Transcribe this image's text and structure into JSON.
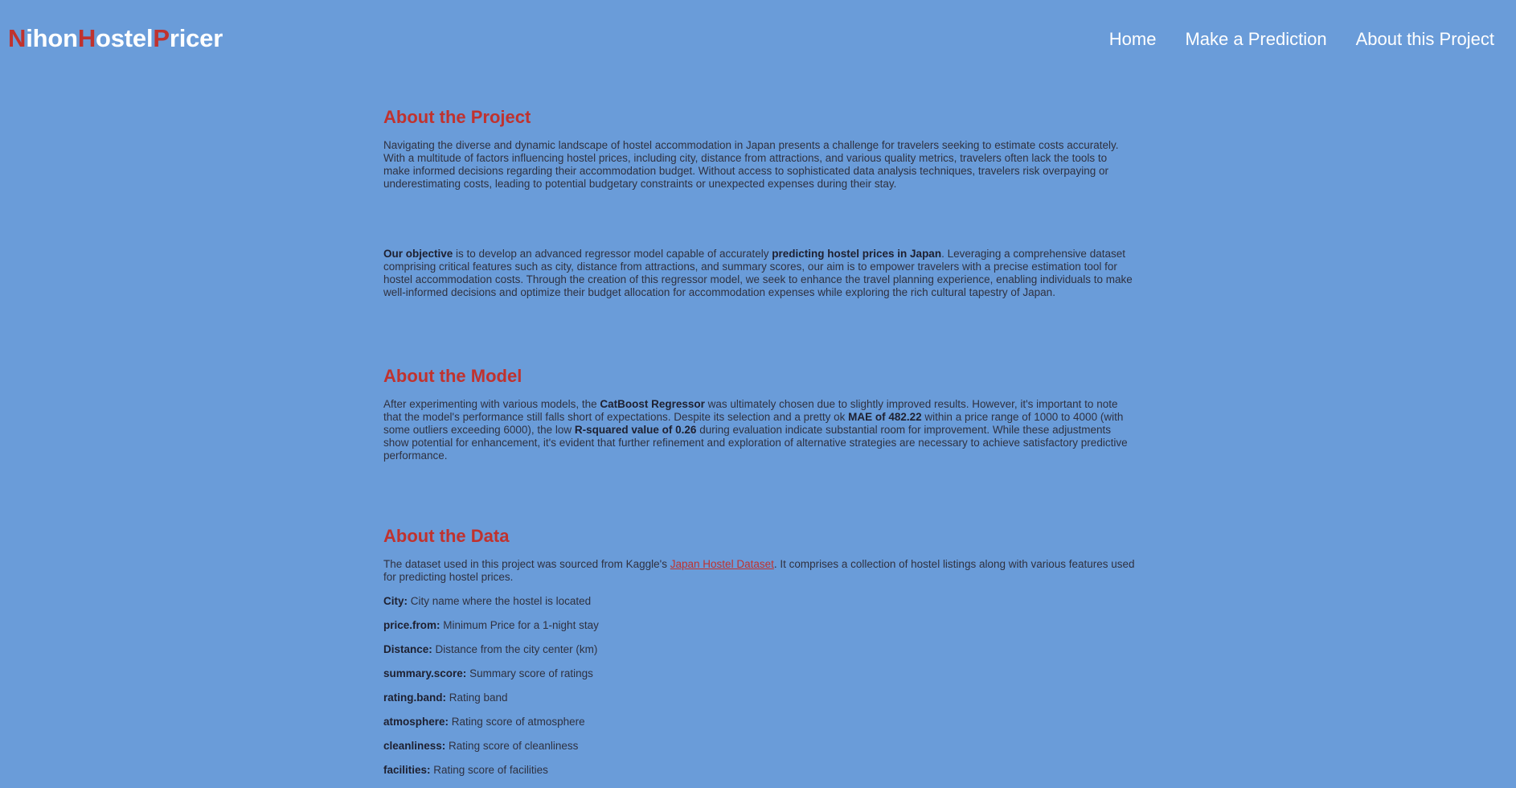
{
  "brand": {
    "letters": [
      "N",
      "ihon",
      "H",
      "ostel",
      "P",
      "ricer"
    ]
  },
  "nav": {
    "home": "Home",
    "predict": "Make a Prediction",
    "about": "About this Project"
  },
  "colors": {
    "background": "#6a9cd9",
    "accent": "#c0322e",
    "nav_text": "#ffffff",
    "body_text": "#2f3140"
  },
  "project": {
    "heading": "About the Project",
    "para1": "Navigating the diverse and dynamic landscape of hostel accommodation in Japan presents a challenge for travelers seeking to estimate costs accurately. With a multitude of factors influencing hostel prices, including city, distance from attractions, and various quality metrics, travelers often lack the tools to make informed decisions regarding their accommodation budget. Without access to sophisticated data analysis techniques, travelers risk overpaying or underestimating costs, leading to potential budgetary constraints or unexpected expenses during their stay.",
    "objective_bold": "Our objective",
    "objective_text1": " is to develop an advanced regressor model capable of accurately ",
    "objective_bold2": "predicting hostel prices in Japan",
    "objective_text2": ". Leveraging a comprehensive dataset comprising critical features such as city, distance from attractions, and summary scores, our aim is to empower travelers with a precise estimation tool for hostel accommodation costs. Through the creation of this regressor model, we seek to enhance the travel planning experience, enabling individuals to make well-informed decisions and optimize their budget allocation for accommodation expenses while exploring the rich cultural tapestry of Japan."
  },
  "model": {
    "heading": "About the Model",
    "t1": "After experimenting with various models, the ",
    "b1": "CatBoost Regressor",
    "t2": " was ultimately chosen due to slightly improved results. However, it's important to note that the model's performance still falls short of expectations. Despite its selection and a pretty ok ",
    "b2": "MAE of 482.22",
    "t3": " within a price range of 1000 to 4000 (with some outliers exceeding 6000), the low ",
    "b3": "R-squared value of 0.26",
    "t4": " during evaluation indicate substantial room for improvement. While these adjustments show potential for enhancement, it's evident that further refinement and exploration of alternative strategies are necessary to achieve satisfactory predictive performance."
  },
  "data": {
    "heading": "About the Data",
    "intro1": "The dataset used in this project was sourced from Kaggle's ",
    "link": "Japan Hostel Dataset",
    "intro2": ". It comprises a collection of hostel listings along with various features used for predicting hostel prices.",
    "features": [
      {
        "name": "City:",
        "desc": " City name where the hostel is located"
      },
      {
        "name": "price.from:",
        "desc": " Minimum Price for a 1-night stay"
      },
      {
        "name": "Distance:",
        "desc": " Distance from the city center (km)"
      },
      {
        "name": "summary.score:",
        "desc": " Summary score of ratings"
      },
      {
        "name": "rating.band:",
        "desc": " Rating band"
      },
      {
        "name": "atmosphere:",
        "desc": " Rating score of atmosphere"
      },
      {
        "name": "cleanliness:",
        "desc": " Rating score of cleanliness"
      },
      {
        "name": "facilities:",
        "desc": " Rating score of facilities"
      }
    ]
  }
}
